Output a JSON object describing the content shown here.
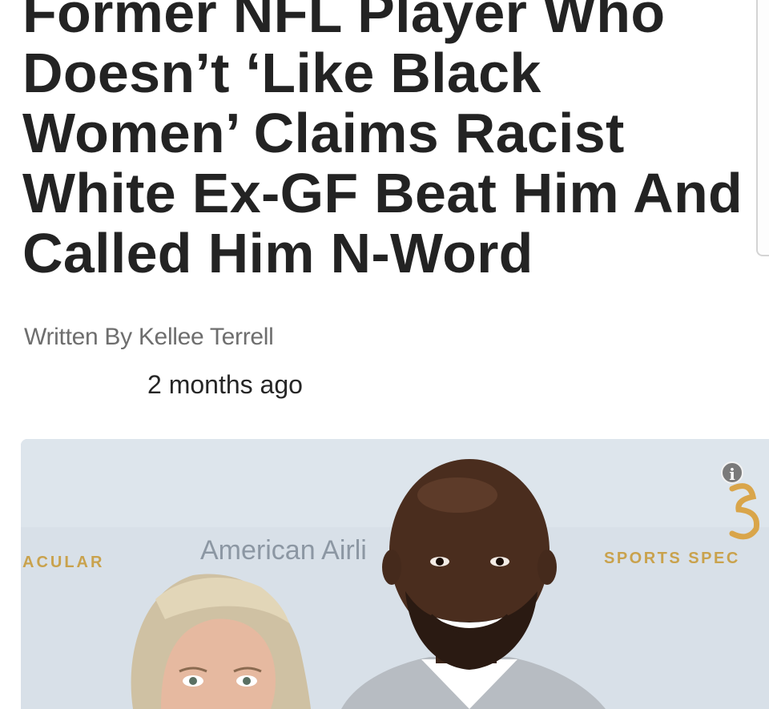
{
  "article": {
    "headline": "Former NFL Player Who Doesn’t ‘Like Black Women’ Claims Racist White Ex-GF Beat Him And Called Him N-Word",
    "byline": "Written By Kellee Terrell",
    "timestamp": "2 months ago"
  },
  "photo": {
    "backdrop_left": "ACULAR",
    "backdrop_center": "American Airli",
    "backdrop_right": "SPORTS SPEC",
    "info_icon": "i"
  },
  "colors": {
    "headline": "#232323",
    "byline": "#6e6e6e",
    "backdrop": "#d8e0e8",
    "logo_gold": "#d9a54a"
  },
  "icons": {
    "info": "info-icon",
    "logo": "sponsor-logo-icon"
  }
}
